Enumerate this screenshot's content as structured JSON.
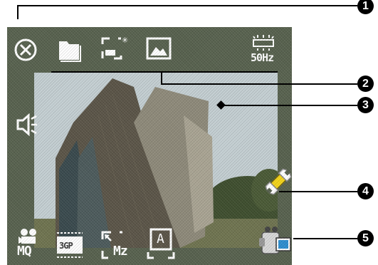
{
  "screen": {
    "frequency_label": "50Hz",
    "format_label": "3GP",
    "quality_label": "MQ",
    "zoom_label": "Mz",
    "shutter_label": "A"
  },
  "callouts": [
    "1",
    "2",
    "3",
    "4",
    "5"
  ],
  "icons": {
    "top_left": [
      "close-icon",
      "folder-icon",
      "capture-mode-icon",
      "album-icon",
      "flicker-icon"
    ],
    "left": [
      "speaker-icon"
    ],
    "bottom": [
      "video-quality-icon",
      "format-icon",
      "zoom-icon",
      "auto-mode-icon"
    ],
    "right": [
      "settings-wrench-icon",
      "camcorder-icon"
    ]
  },
  "colors": {
    "icon": "#ffffff",
    "screen_bg": "#58624f",
    "callout": "#000000",
    "wrench_handle": "#f2d31a"
  }
}
